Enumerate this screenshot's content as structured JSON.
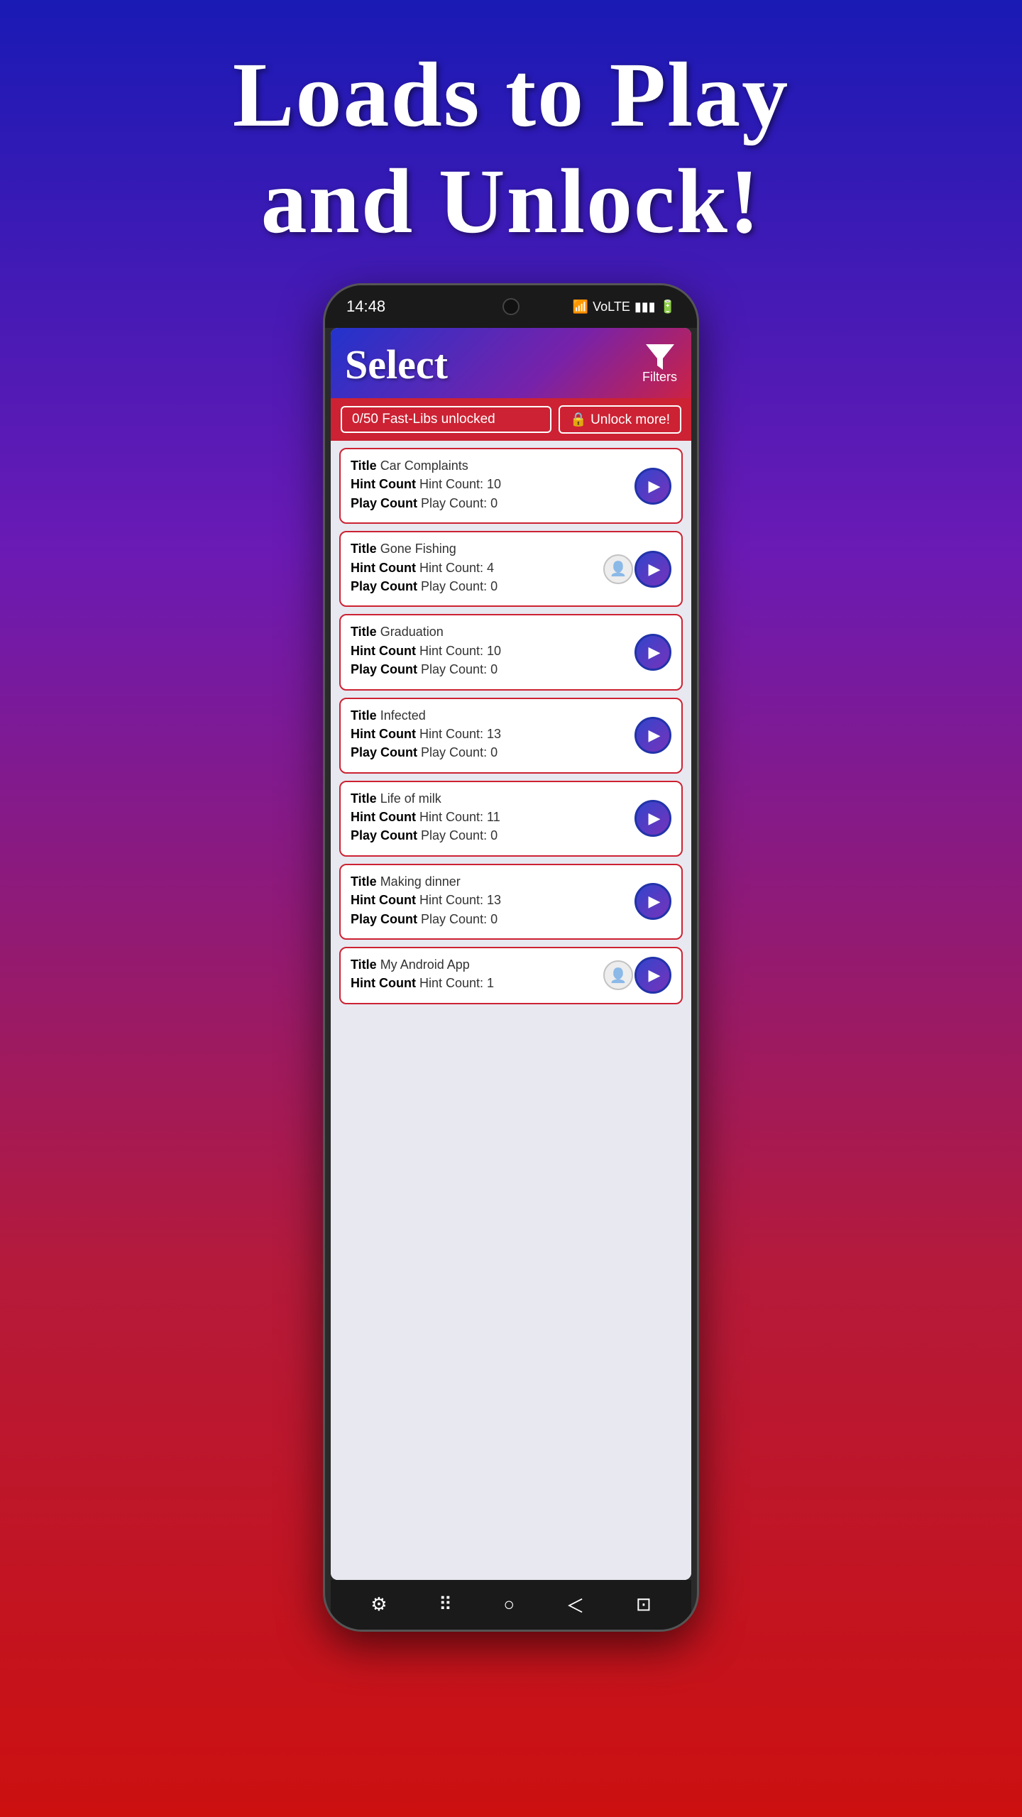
{
  "hero": {
    "title_line1": "Loads to Play",
    "title_line2": "and Unlock!"
  },
  "status_bar": {
    "time": "14:48",
    "icons": "WiFi VoLTE ▮▮▮ 🔋"
  },
  "app": {
    "header": {
      "title": "Select",
      "filter_label": "Filters",
      "filter_icon": "▼"
    },
    "unlock_bar": {
      "count_text": "0/50 Fast-Libs unlocked",
      "unlock_btn": "🔒 Unlock more!"
    },
    "list_items": [
      {
        "title": "Car Complaints",
        "hint_count": "Hint Count: 10",
        "play_count": "Play Count: 0",
        "user_created": false
      },
      {
        "title": "Gone Fishing",
        "hint_count": "Hint Count: 4",
        "play_count": "Play Count: 0",
        "user_created": true
      },
      {
        "title": "Graduation",
        "hint_count": "Hint Count: 10",
        "play_count": "Play Count: 0",
        "user_created": false
      },
      {
        "title": "Infected",
        "hint_count": "Hint Count: 13",
        "play_count": "Play Count: 0",
        "user_created": false
      },
      {
        "title": "Life of milk",
        "hint_count": "Hint Count: 11",
        "play_count": "Play Count: 0",
        "user_created": false
      },
      {
        "title": "Making dinner",
        "hint_count": "Hint Count: 13",
        "play_count": "Play Count: 0",
        "user_created": false
      },
      {
        "title": "My Android App",
        "hint_count": "Hint Count: 1",
        "play_count": null,
        "user_created": true,
        "partial": true
      }
    ],
    "labels": {
      "title": "Title",
      "hint_count": "Hint Count",
      "play_count": "Play Count"
    }
  }
}
